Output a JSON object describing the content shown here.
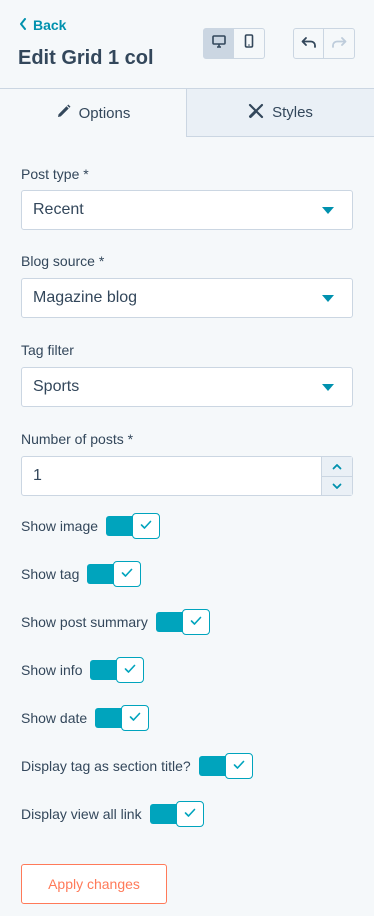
{
  "header": {
    "back_label": "Back",
    "title": "Edit Grid 1 col"
  },
  "tabs": [
    {
      "label": "Options",
      "icon": "pencil-icon",
      "active": true
    },
    {
      "label": "Styles",
      "icon": "brush-icon",
      "active": false
    }
  ],
  "fields": {
    "post_type": {
      "label": "Post type *",
      "value": "Recent"
    },
    "blog_source": {
      "label": "Blog source *",
      "value": "Magazine blog"
    },
    "tag_filter": {
      "label": "Tag filter",
      "value": "Sports"
    },
    "number_of_posts": {
      "label": "Number of posts *",
      "value": "1"
    }
  },
  "toggles": [
    {
      "label": "Show image",
      "on": true
    },
    {
      "label": "Show tag",
      "on": true
    },
    {
      "label": "Show post summary",
      "on": true
    },
    {
      "label": "Show info",
      "on": true
    },
    {
      "label": "Show date",
      "on": true
    },
    {
      "label": "Display tag as section title?",
      "on": true
    },
    {
      "label": "Display view all link",
      "on": true
    }
  ],
  "apply_label": "Apply changes",
  "colors": {
    "accent": "#00a4bd",
    "link": "#0091ae",
    "text": "#33475b",
    "border": "#cbd6e2",
    "cta": "#ff7a59",
    "background": "#f5f8fa"
  }
}
